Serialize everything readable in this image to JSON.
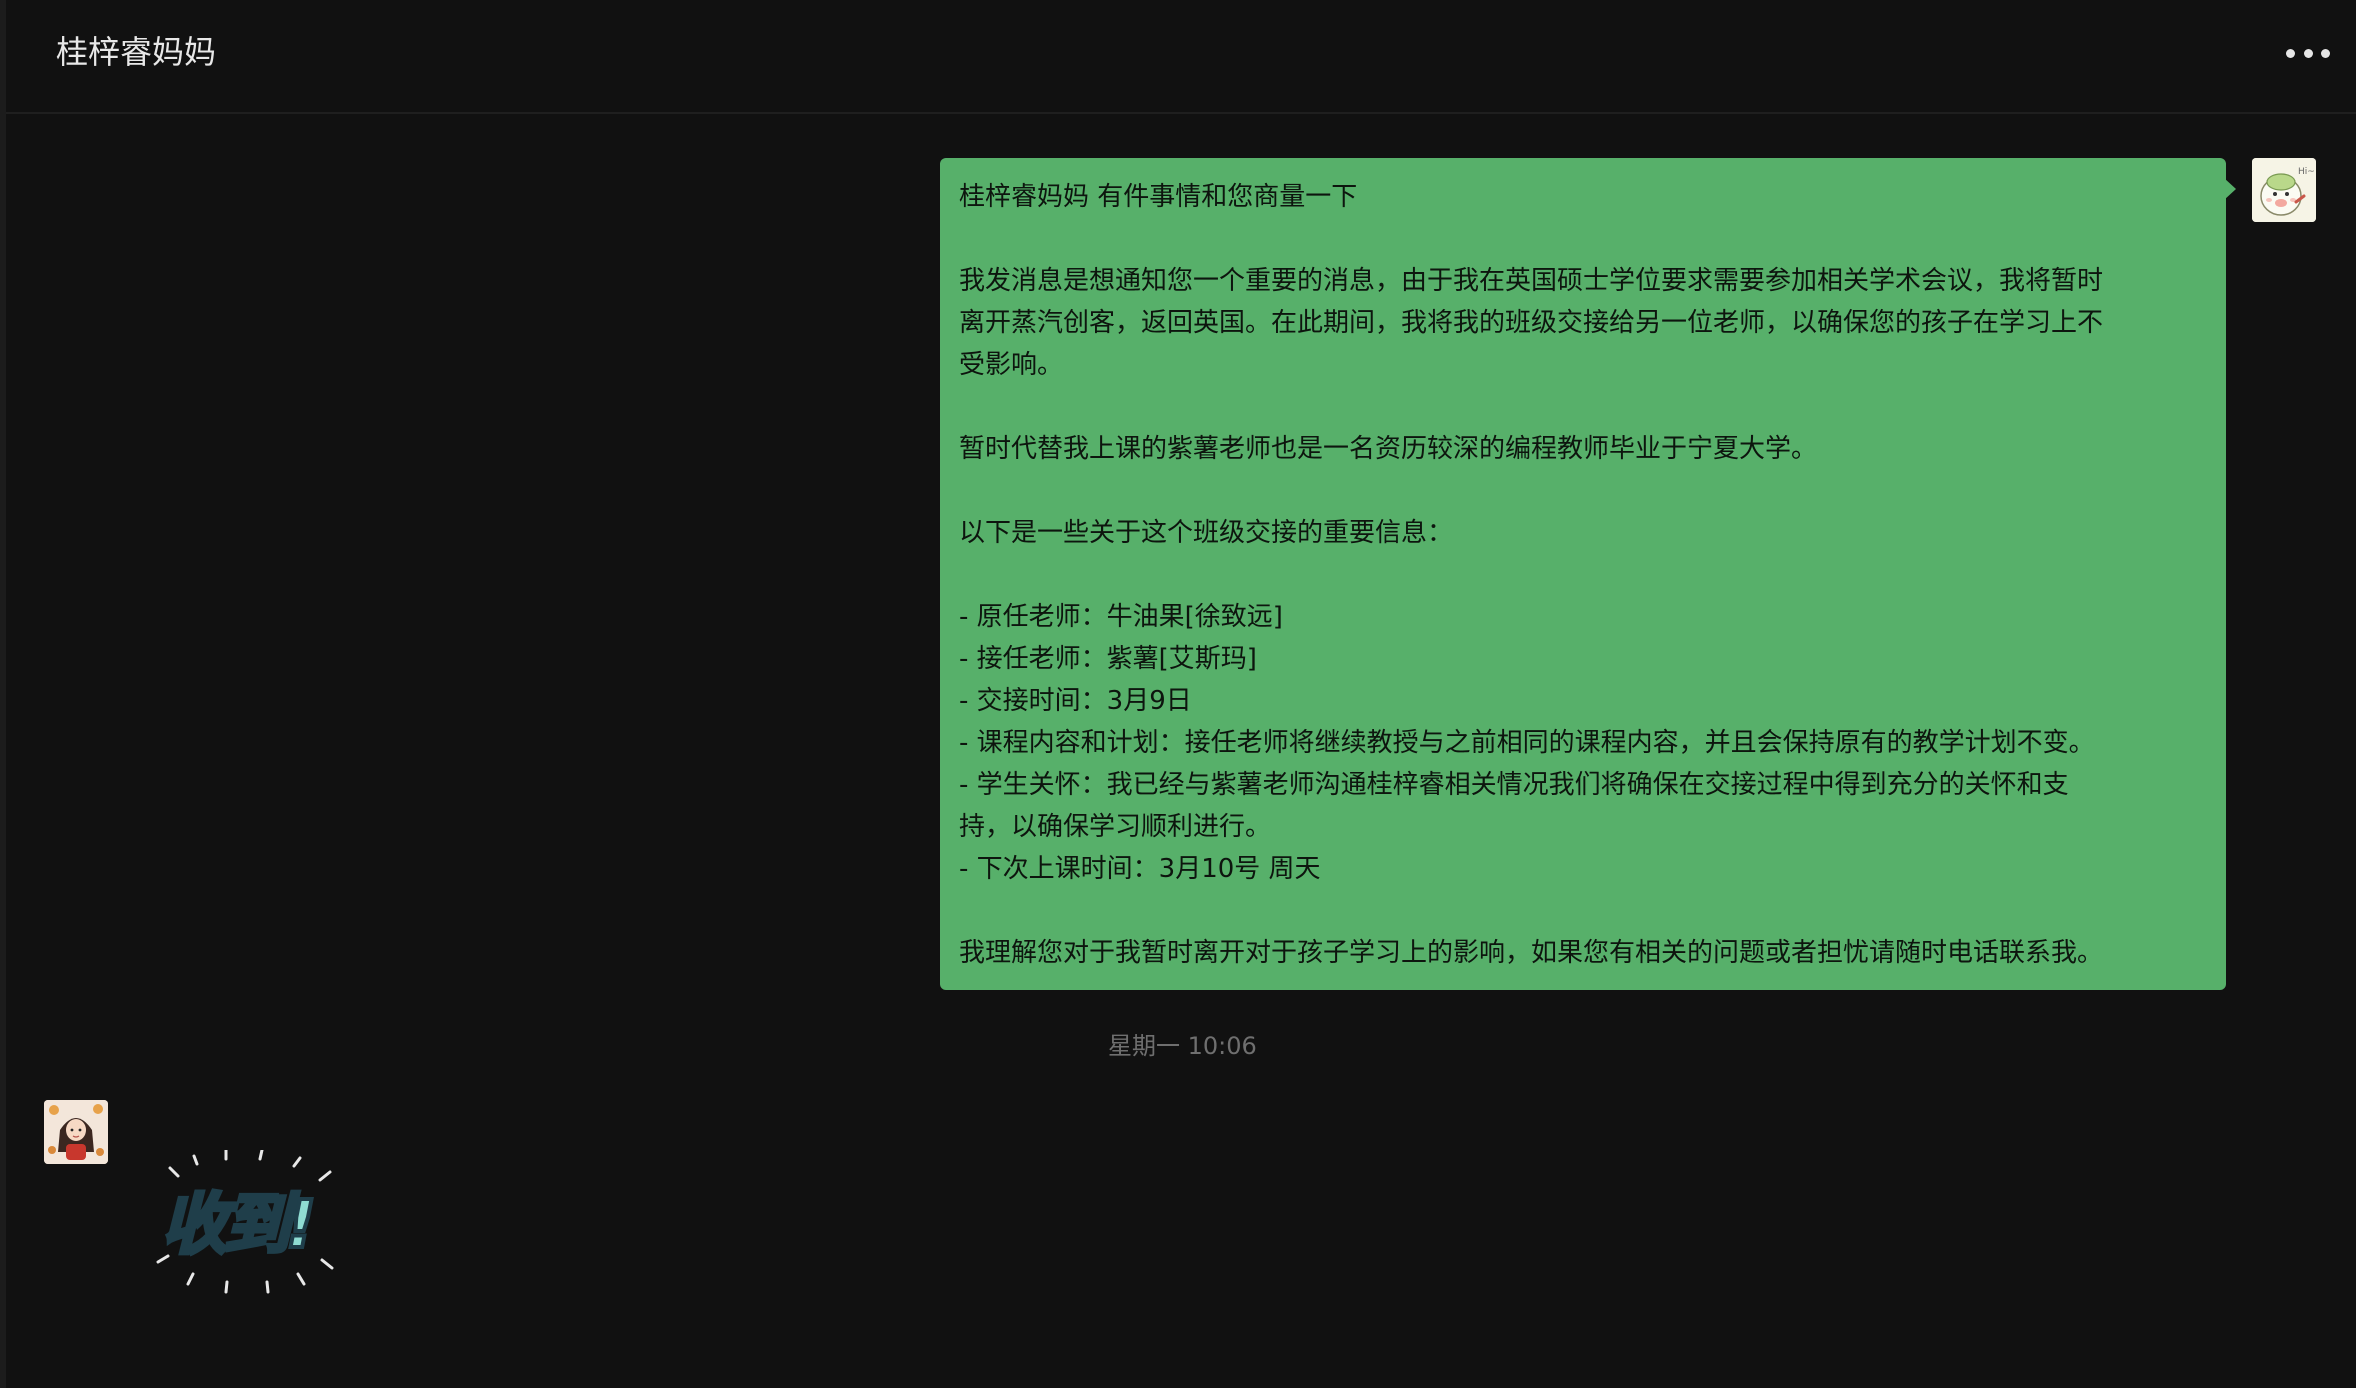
{
  "header": {
    "title": "桂梓睿妈妈",
    "more_icon": "more-horizontal-icon"
  },
  "message_out": {
    "lines": [
      "桂梓睿妈妈 有件事情和您商量一下",
      "",
      "我发消息是想通知您一个重要的消息，由于我在英国硕士学位要求需要参加相关学术会议，我将暂时",
      "离开蒸汽创客，返回英国。在此期间，我将我的班级交接给另一位老师，以确保您的孩子在学习上不",
      "受影响。",
      "",
      "暂时代替我上课的紫薯老师也是一名资历较深的编程教师毕业于宁夏大学。",
      "",
      "以下是一些关于这个班级交接的重要信息：",
      "",
      "- 原任老师：牛油果[徐致远]",
      "- 接任老师：紫薯[艾斯玛]",
      "- 交接时间：3月9日",
      "- 课程内容和计划：接任老师将继续教授与之前相同的课程内容，并且会保持原有的教学计划不变。",
      "- 学生关怀：我已经与紫薯老师沟通桂梓睿相关情况我们将确保在交接过程中得到充分的关怀和支",
      "持，以确保学习顺利进行。",
      "- 下次上课时间：3月10号 周天",
      "",
      "我理解您对于我暂时离开对于孩子学习上的影响，如果您有相关的问题或者担忧请随时电话联系我。"
    ],
    "bubble_color": "#57b06a"
  },
  "timestamp": "星期一 10:06",
  "sticker": {
    "text": "收到!",
    "colors": {
      "fill": "#8fdcd2",
      "outline": "#1f3e4a"
    }
  },
  "avatar_avatar_right_text": "Hi~"
}
